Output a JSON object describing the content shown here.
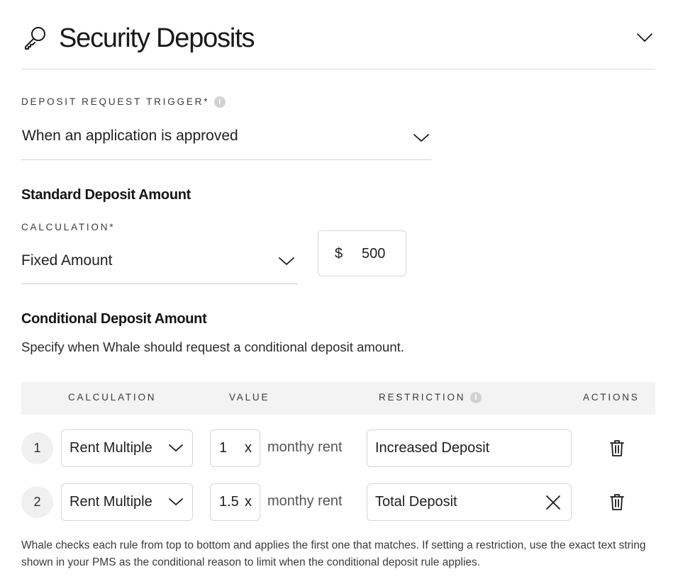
{
  "header": {
    "title": "Security Deposits",
    "icon": "key-icon"
  },
  "trigger": {
    "label": "DEPOSIT REQUEST TRIGGER*",
    "value": "When an application is approved"
  },
  "standard": {
    "heading": "Standard Deposit Amount",
    "calc_label": "CALCULATION*",
    "calc_value": "Fixed Amount",
    "currency": "$",
    "amount": "500"
  },
  "conditional": {
    "heading": "Conditional Deposit Amount",
    "description": "Specify when Whale should request a conditional deposit amount.",
    "columns": {
      "calculation": "CALCULATION",
      "value": "VALUE",
      "restriction": "RESTRICTION",
      "actions": "ACTIONS"
    },
    "rows": [
      {
        "num": "1",
        "calculation": "Rent Multiple",
        "value": "1",
        "multiplier": "x",
        "suffix": "monthy rent",
        "restriction": "Increased Deposit",
        "clearable": false
      },
      {
        "num": "2",
        "calculation": "Rent Multiple",
        "value": "1.5",
        "multiplier": "x",
        "suffix": "monthy rent",
        "restriction": "Total Deposit",
        "clearable": true
      }
    ],
    "note": "Whale checks each rule from top to bottom and applies the first one that matches. If setting a restriction, use the exact text string shown in your PMS as the conditional reason to limit when the conditional deposit rule applies."
  },
  "icons": {
    "info": "i"
  }
}
